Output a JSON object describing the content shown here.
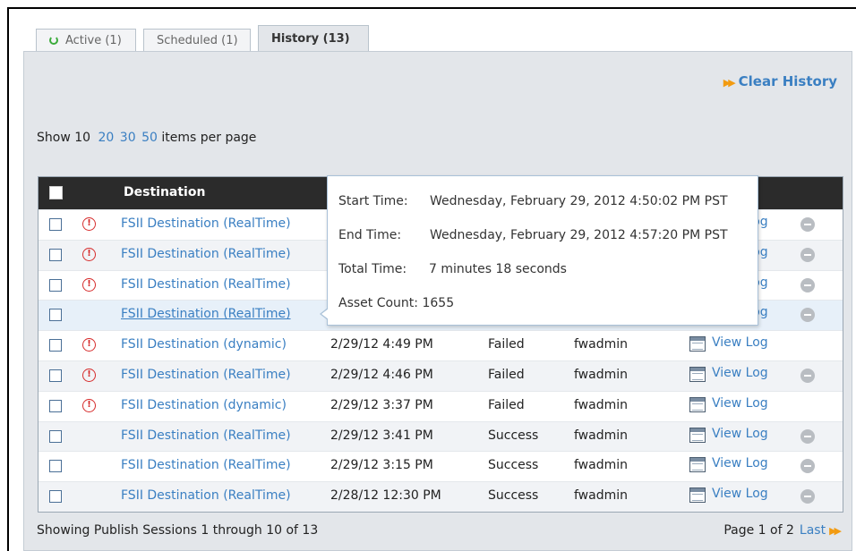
{
  "tabs": [
    {
      "label": "Active (1)"
    },
    {
      "label": "Scheduled (1)"
    },
    {
      "label": "History (13)"
    }
  ],
  "actions": {
    "clear_history": "Clear History"
  },
  "pagination_top": {
    "show": "Show",
    "current": "10",
    "options": [
      "20",
      "30",
      "50"
    ],
    "suffix": "items per page"
  },
  "table": {
    "header": {
      "destination": "Destination"
    },
    "rows": [
      {
        "destination": "FSII Destination (RealTime)",
        "date": "",
        "status": "",
        "user": "",
        "log": "View Log",
        "error": true,
        "removable": true
      },
      {
        "destination": "FSII Destination (RealTime)",
        "date": "",
        "status": "",
        "user": "",
        "log": "View Log",
        "error": true,
        "removable": true
      },
      {
        "destination": "FSII Destination (RealTime)",
        "date": "",
        "status": "",
        "user": "",
        "log": "View Log",
        "error": true,
        "removable": true
      },
      {
        "destination": "FSII Destination (RealTime)",
        "date": "",
        "status": "",
        "user": "",
        "log": "View Log",
        "error": false,
        "removable": true
      },
      {
        "destination": "FSII Destination (dynamic)",
        "date": "2/29/12 4:49 PM",
        "status": "Failed",
        "user": "fwadmin",
        "log": "View Log",
        "error": true,
        "removable": false
      },
      {
        "destination": "FSII Destination (RealTime)",
        "date": "2/29/12 4:46 PM",
        "status": "Failed",
        "user": "fwadmin",
        "log": "View Log",
        "error": true,
        "removable": true
      },
      {
        "destination": "FSII Destination (dynamic)",
        "date": "2/29/12 3:37 PM",
        "status": "Failed",
        "user": "fwadmin",
        "log": "View Log",
        "error": true,
        "removable": false
      },
      {
        "destination": "FSII Destination (RealTime)",
        "date": "2/29/12 3:41 PM",
        "status": "Success",
        "user": "fwadmin",
        "log": "View Log",
        "error": false,
        "removable": true
      },
      {
        "destination": "FSII Destination (RealTime)",
        "date": "2/29/12 3:15 PM",
        "status": "Success",
        "user": "fwadmin",
        "log": "View Log",
        "error": false,
        "removable": true
      },
      {
        "destination": "FSII Destination (RealTime)",
        "date": "2/28/12 12:30 PM",
        "status": "Success",
        "user": "fwadmin",
        "log": "View Log",
        "error": false,
        "removable": true
      }
    ]
  },
  "tooltip": {
    "start_label": "Start Time:",
    "start_value": "Wednesday, February 29, 2012 4:50:02 PM PST",
    "end_label": "End Time:",
    "end_value": "Wednesday, February 29, 2012 4:57:20 PM PST",
    "total_label": "Total Time:",
    "total_value": "7 minutes 18 seconds",
    "asset_label": "Asset Count:",
    "asset_value": "1655"
  },
  "footer": {
    "summary": "Showing Publish Sessions 1 through 10 of 13",
    "page": "Page 1 of 2",
    "last": "Last"
  },
  "colors": {
    "link": "#3a7fc2",
    "accent_arrow": "#f29b11",
    "error": "#d62b2b",
    "header_bg": "#2b2b2b"
  },
  "icons": {
    "refresh": "refresh-icon",
    "arrow": "double-arrow-icon",
    "error": "error-icon",
    "log": "log-icon",
    "remove": "remove-icon"
  }
}
